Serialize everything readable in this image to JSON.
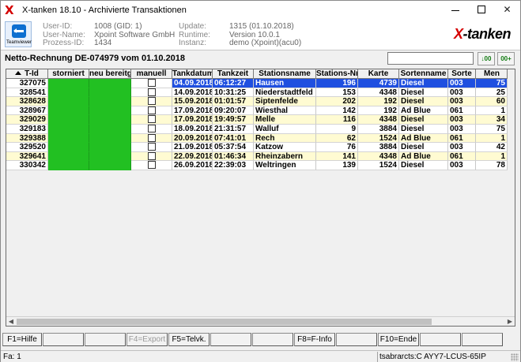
{
  "window": {
    "title": "X-tanken 18.10 - Archivierte Transaktionen",
    "app_icon": "X",
    "buttons": {
      "minimize": "—",
      "maximize": "☐",
      "close": "✕"
    }
  },
  "header": {
    "teamviewer_label": "Teamviewer",
    "user_id_label": "User-ID:",
    "user_id": "1008 (GID: 1)",
    "user_name_label": "User-Name:",
    "user_name": "Xpoint Software GmbH",
    "process_id_label": "Prozess-ID:",
    "process_id": "1434",
    "update_label": "Update:",
    "update": "1315 (01.10.2018)",
    "runtime_label": "Runtime:",
    "runtime": "Version 10.0.1",
    "instance_label": "Instanz:",
    "instance": "demo (Xpoint)(acu0)",
    "brand_x": "X",
    "brand_rest": "-tanken"
  },
  "toolbar": {
    "title": "Netto-Rechnung DE-074979 vom 01.10.2018",
    "search_value": "",
    "btn1": "↓00",
    "btn2": "00+"
  },
  "table": {
    "columns": [
      "T-Id",
      "storniert",
      "neu bereitge",
      "manuell",
      "Tankdatum",
      "Tankzeit",
      "Stationsname",
      "Stations-Nr.",
      "Karte",
      "Sortenname",
      "Sorte",
      "Men"
    ],
    "rows": [
      {
        "tid": "327075",
        "datum": "04.09.2018",
        "zeit": "06:12:27",
        "station": "Hausen",
        "nr": "196",
        "karte": "4739",
        "sortenname": "Diesel",
        "sorte": "003",
        "menge": "75"
      },
      {
        "tid": "328541",
        "datum": "14.09.2018",
        "zeit": "10:31:25",
        "station": "Niederstadtfeld",
        "nr": "153",
        "karte": "4348",
        "sortenname": "Diesel",
        "sorte": "003",
        "menge": "25"
      },
      {
        "tid": "328628",
        "datum": "15.09.2018",
        "zeit": "01:01:57",
        "station": "Siptenfelde",
        "nr": "202",
        "karte": "192",
        "sortenname": "Diesel",
        "sorte": "003",
        "menge": "60"
      },
      {
        "tid": "328967",
        "datum": "17.09.2018",
        "zeit": "09:20:07",
        "station": "Wiesthal",
        "nr": "142",
        "karte": "192",
        "sortenname": "Ad Blue",
        "sorte": "061",
        "menge": "1"
      },
      {
        "tid": "329029",
        "datum": "17.09.2018",
        "zeit": "19:49:57",
        "station": "Melle",
        "nr": "116",
        "karte": "4348",
        "sortenname": "Diesel",
        "sorte": "003",
        "menge": "34"
      },
      {
        "tid": "329183",
        "datum": "18.09.2018",
        "zeit": "21:31:57",
        "station": "Walluf",
        "nr": "9",
        "karte": "3884",
        "sortenname": "Diesel",
        "sorte": "003",
        "menge": "75"
      },
      {
        "tid": "329388",
        "datum": "20.09.2018",
        "zeit": "07:41:01",
        "station": "Rech",
        "nr": "62",
        "karte": "1524",
        "sortenname": "Ad Blue",
        "sorte": "061",
        "menge": "1"
      },
      {
        "tid": "329520",
        "datum": "21.09.2018",
        "zeit": "05:37:54",
        "station": "Katzow",
        "nr": "76",
        "karte": "3884",
        "sortenname": "Diesel",
        "sorte": "003",
        "menge": "42"
      },
      {
        "tid": "329641",
        "datum": "22.09.2018",
        "zeit": "01:46:34",
        "station": "Rheinzabern",
        "nr": "141",
        "karte": "4348",
        "sortenname": "Ad Blue",
        "sorte": "061",
        "menge": "1"
      },
      {
        "tid": "330342",
        "datum": "26.09.2018",
        "zeit": "22:39:03",
        "station": "Weltringen",
        "nr": "139",
        "karte": "1524",
        "sortenname": "Diesel",
        "sorte": "003",
        "menge": "78"
      }
    ]
  },
  "fkeys": [
    "F1=Hilfe",
    "",
    "",
    "F4=Export",
    "F5=Telvk.",
    "",
    "",
    "F8=F-Info",
    "",
    "F10=Ende",
    "",
    ""
  ],
  "status": {
    "left": "Fa: 1",
    "right": "tsabrarcts:C AYY7-LCUS-65IP"
  },
  "colors": {
    "selection": "#1f4fe0",
    "green_flag": "#22c022",
    "row_alt": "#fffbd2",
    "brand_red": "#d40000"
  }
}
